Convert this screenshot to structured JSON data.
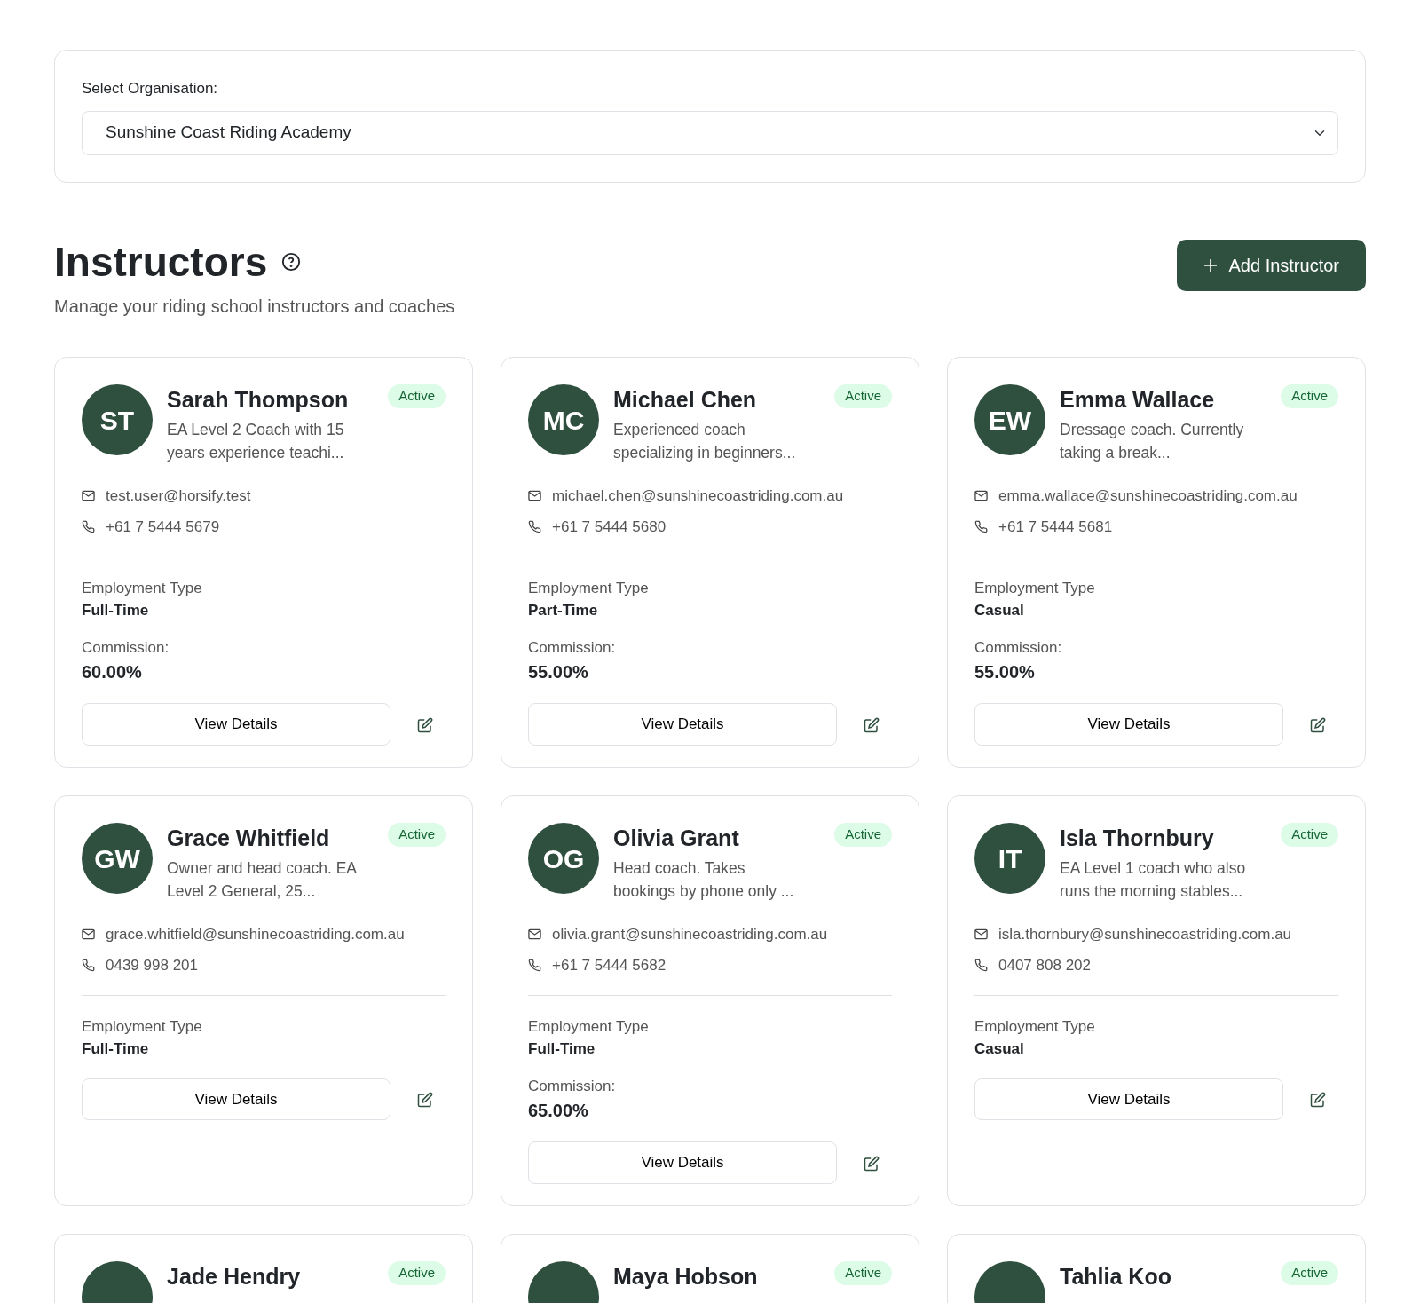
{
  "organisation": {
    "label": "Select Organisation:",
    "value": "Sunshine Coast Riding Academy"
  },
  "header": {
    "title": "Instructors",
    "subtitle": "Manage your riding school instructors and coaches",
    "add_button": "Add Instructor"
  },
  "instructors": [
    {
      "initials": "ST",
      "name": "Sarah Thompson",
      "status": "Active",
      "description": "EA Level 2 Coach with 15 years experience teachi...",
      "email": "test.user@horsify.test",
      "phone": "+61 7 5444 5679",
      "employment_label": "Employment Type",
      "employment_type": "Full-Time",
      "commission_label": "Commission:",
      "commission": "60.00%",
      "view_button": "View Details"
    },
    {
      "initials": "MC",
      "name": "Michael Chen",
      "status": "Active",
      "description": "Experienced coach specializing in beginners...",
      "email": "michael.chen@sunshinecoastriding.com.au",
      "phone": "+61 7 5444 5680",
      "employment_label": "Employment Type",
      "employment_type": "Part-Time",
      "commission_label": "Commission:",
      "commission": "55.00%",
      "view_button": "View Details"
    },
    {
      "initials": "EW",
      "name": "Emma Wallace",
      "status": "Active",
      "description": "Dressage coach. Currently taking a break...",
      "email": "emma.wallace@sunshinecoastriding.com.au",
      "phone": "+61 7 5444 5681",
      "employment_label": "Employment Type",
      "employment_type": "Casual",
      "commission_label": "Commission:",
      "commission": "55.00%",
      "view_button": "View Details"
    },
    {
      "initials": "GW",
      "name": "Grace Whitfield",
      "status": "Active",
      "description": "Owner and head coach. EA Level 2 General, 25...",
      "email": "grace.whitfield@sunshinecoastriding.com.au",
      "phone": "0439 998 201",
      "employment_label": "Employment Type",
      "employment_type": "Full-Time",
      "view_button": "View Details"
    },
    {
      "initials": "OG",
      "name": "Olivia Grant",
      "status": "Active",
      "description": "Head coach. Takes bookings by phone only ...",
      "email": "olivia.grant@sunshinecoastriding.com.au",
      "phone": "+61 7 5444 5682",
      "employment_label": "Employment Type",
      "employment_type": "Full-Time",
      "commission_label": "Commission:",
      "commission": "65.00%",
      "view_button": "View Details"
    },
    {
      "initials": "IT",
      "name": "Isla Thornbury",
      "status": "Active",
      "description": "EA Level 1 coach who also runs the morning stables...",
      "email": "isla.thornbury@sunshinecoastriding.com.au",
      "phone": "0407 808 202",
      "employment_label": "Employment Type",
      "employment_type": "Casual",
      "view_button": "View Details"
    },
    {
      "name": "Jade Hendry",
      "status": "Active"
    },
    {
      "name": "Maya Hobson",
      "status": "Active"
    },
    {
      "name": "Tahlia Koo",
      "status": "Active"
    }
  ]
}
